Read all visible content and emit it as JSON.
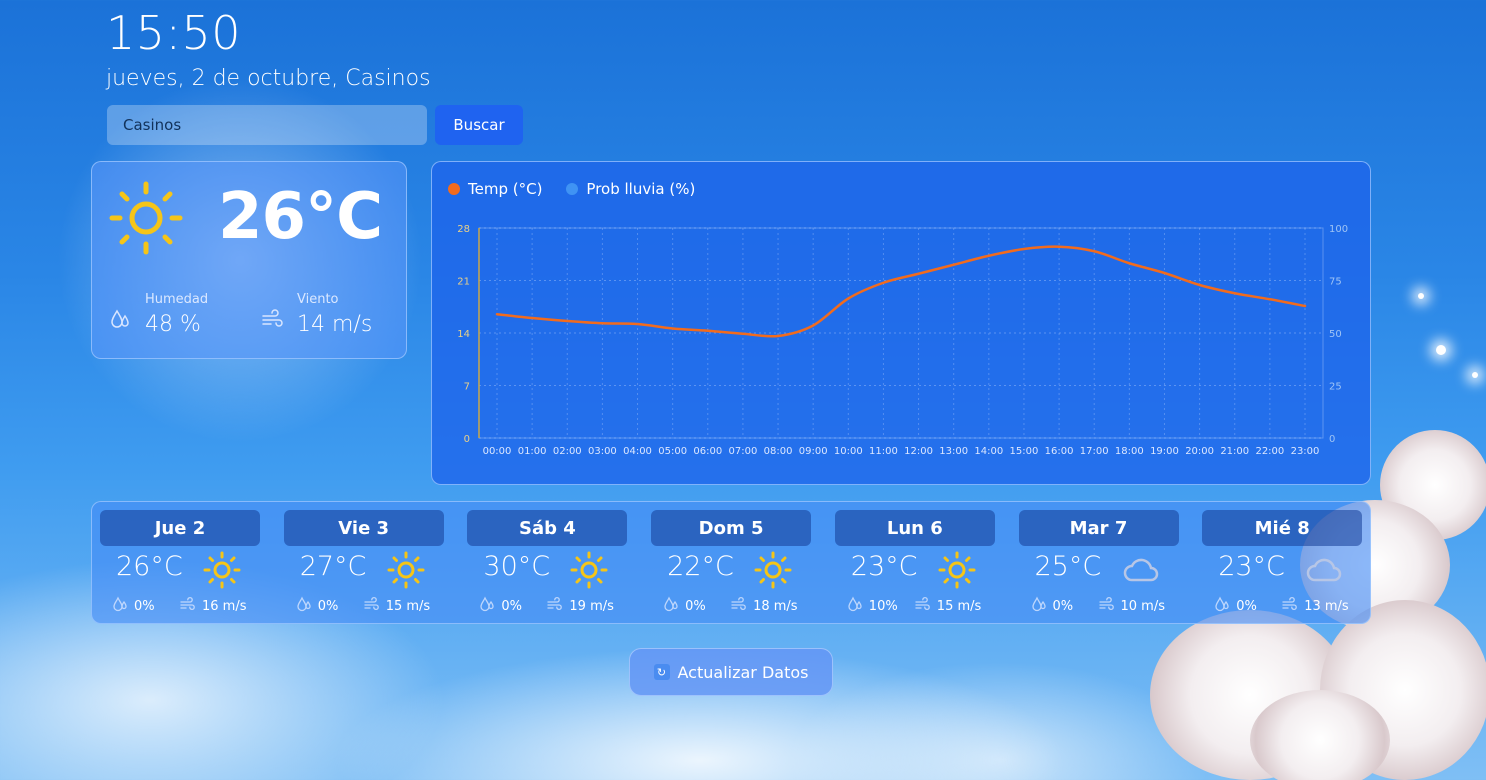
{
  "header": {
    "time": "15:50",
    "date": "jueves, 2 de octubre, Casinos"
  },
  "search": {
    "value": "Casinos",
    "button_label": "Buscar"
  },
  "current": {
    "icon": "sun-icon",
    "temperature": "26°C",
    "humidity_label": "Humedad",
    "humidity_value": "48 %",
    "wind_label": "Viento",
    "wind_value": "14 m/s"
  },
  "chart_data": {
    "type": "line",
    "title": "",
    "series": [
      {
        "name": "Temp (°C)",
        "color": "#f26b1d",
        "axis": "left",
        "values": [
          16.5,
          16.0,
          15.6,
          15.3,
          15.2,
          14.6,
          14.3,
          13.9,
          13.6,
          15.0,
          18.6,
          20.7,
          21.9,
          23.1,
          24.3,
          25.2,
          25.5,
          24.9,
          23.3,
          22.0,
          20.4,
          19.3,
          18.5,
          17.6
        ]
      },
      {
        "name": "Prob lluvia (%)",
        "color": "#3f93f4",
        "axis": "right",
        "values": [
          0,
          0,
          0,
          0,
          0,
          0,
          0,
          0,
          0,
          0,
          0,
          0,
          0,
          0,
          0,
          0,
          0,
          0,
          0,
          0,
          0,
          0,
          0,
          0
        ]
      }
    ],
    "categories": [
      "00:00",
      "01:00",
      "02:00",
      "03:00",
      "04:00",
      "05:00",
      "06:00",
      "07:00",
      "08:00",
      "09:00",
      "10:00",
      "11:00",
      "12:00",
      "13:00",
      "14:00",
      "15:00",
      "16:00",
      "17:00",
      "18:00",
      "19:00",
      "20:00",
      "21:00",
      "22:00",
      "23:00"
    ],
    "ylim_left": [
      0,
      28
    ],
    "yticks_left": [
      "0",
      "7",
      "14",
      "21",
      "28"
    ],
    "ylim_right": [
      0,
      100
    ],
    "yticks_right": [
      "0",
      "25",
      "50",
      "75",
      "100"
    ],
    "grid": true,
    "legend": "top-left"
  },
  "forecast": [
    {
      "day": "Jue 2",
      "temp": "26°C",
      "icon": "sun-icon",
      "rain": "0%",
      "wind": "16 m/s"
    },
    {
      "day": "Vie 3",
      "temp": "27°C",
      "icon": "sun-icon",
      "rain": "0%",
      "wind": "15 m/s"
    },
    {
      "day": "Sáb 4",
      "temp": "30°C",
      "icon": "sun-icon",
      "rain": "0%",
      "wind": "19 m/s"
    },
    {
      "day": "Dom 5",
      "temp": "22°C",
      "icon": "sun-icon",
      "rain": "0%",
      "wind": "18 m/s"
    },
    {
      "day": "Lun 6",
      "temp": "23°C",
      "icon": "sun-icon",
      "rain": "10%",
      "wind": "15 m/s"
    },
    {
      "day": "Mar 7",
      "temp": "25°C",
      "icon": "cloud-icon",
      "rain": "0%",
      "wind": "10 m/s"
    },
    {
      "day": "Mié 8",
      "temp": "23°C",
      "icon": "cloud-icon",
      "rain": "0%",
      "wind": "13 m/s"
    }
  ],
  "refresh": {
    "icon": "refresh-icon",
    "label": "Actualizar Datos"
  },
  "colors": {
    "sun": "#f5c518",
    "temp_line": "#f26b1d",
    "rain_dot": "#3f93f4",
    "button": "#1f63f0"
  }
}
